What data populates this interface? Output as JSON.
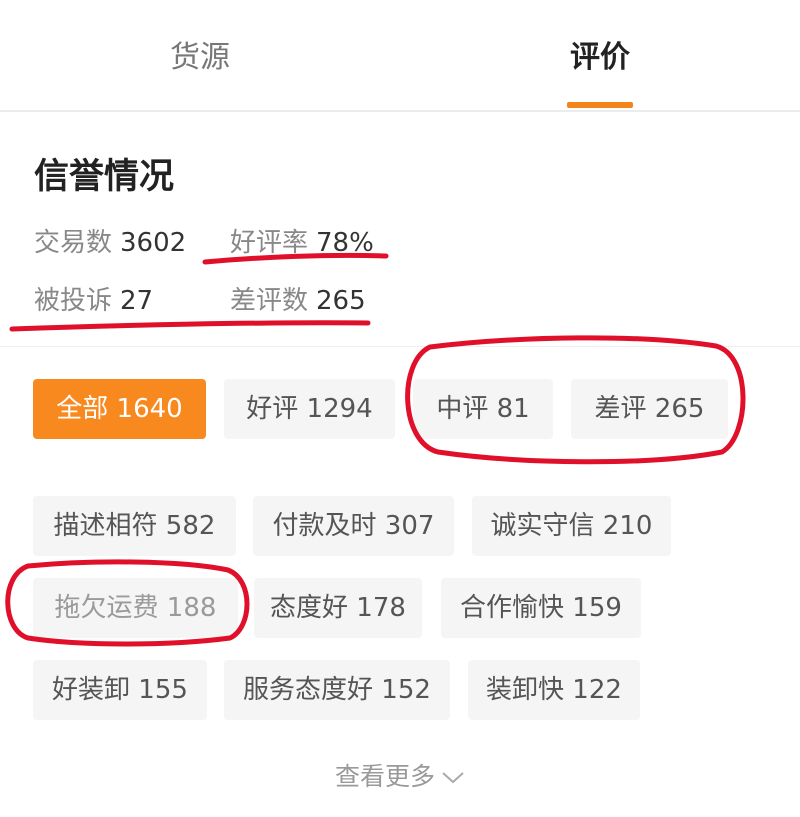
{
  "tabs": [
    {
      "label": "货源"
    },
    {
      "label": "评价"
    }
  ],
  "credit": {
    "title": "信誉情况",
    "trades_label": "交易数",
    "trades_value": "3602",
    "good_rate_label": "好评率",
    "good_rate_value": "78%",
    "complaints_label": "被投诉",
    "complaints_value": "27",
    "bad_count_label": "差评数",
    "bad_count_value": "265"
  },
  "filters": [
    {
      "label": "全部 1640"
    },
    {
      "label": "好评 1294"
    },
    {
      "label": "中评 81"
    },
    {
      "label": "差评 265"
    }
  ],
  "tags": [
    {
      "label": "描述相符 582"
    },
    {
      "label": "付款及时 307"
    },
    {
      "label": "诚实守信 210"
    },
    {
      "label": "拖欠运费 188"
    },
    {
      "label": "态度好 178"
    },
    {
      "label": "合作愉快 159"
    },
    {
      "label": "好装卸 155"
    },
    {
      "label": "服务态度好 152"
    },
    {
      "label": "装卸快 122"
    }
  ],
  "more_label": "查看更多",
  "colors": {
    "accent": "#f7891e",
    "annotation": "#e0102a"
  },
  "icons": {
    "more": "chevron-down-icon"
  }
}
